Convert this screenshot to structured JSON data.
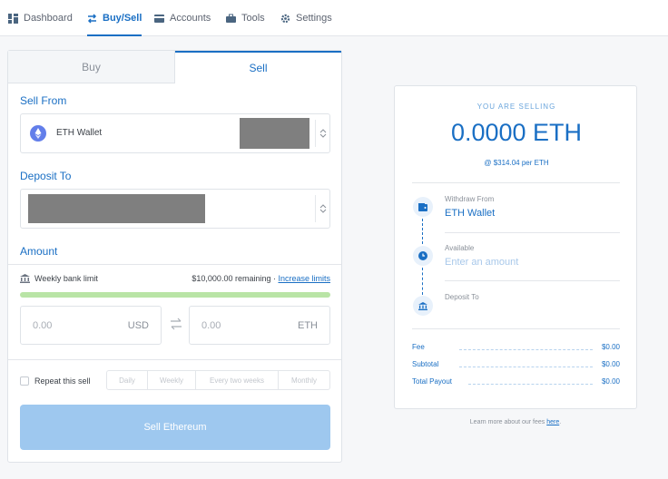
{
  "nav": {
    "items": [
      {
        "label": "Dashboard",
        "icon": "dashboard-icon"
      },
      {
        "label": "Buy/Sell",
        "icon": "swap-arrows-icon",
        "active": true
      },
      {
        "label": "Accounts",
        "icon": "accounts-icon"
      },
      {
        "label": "Tools",
        "icon": "briefcase-icon"
      },
      {
        "label": "Settings",
        "icon": "gear-icon"
      }
    ]
  },
  "tabs": {
    "buy": "Buy",
    "sell": "Sell"
  },
  "form": {
    "sell_from_label": "Sell From",
    "sell_from_value": "ETH Wallet",
    "deposit_to_label": "Deposit To",
    "amount_label": "Amount",
    "limit_label": "Weekly bank limit",
    "limit_remaining": "$10,000.00 remaining ·",
    "increase_limits": "Increase limits",
    "fiat_value": "0.00",
    "fiat_currency": "USD",
    "crypto_value": "0.00",
    "crypto_currency": "ETH",
    "repeat_label": "Repeat this sell",
    "frequencies": [
      "Daily",
      "Weekly",
      "Every two weeks",
      "Monthly"
    ],
    "submit_label": "Sell Ethereum"
  },
  "summary": {
    "kicker": "YOU ARE SELLING",
    "amount": "0.0000 ETH",
    "rate": "@ $314.04 per ETH",
    "withdraw_from_label": "Withdraw From",
    "withdraw_from_value": "ETH Wallet",
    "available_label": "Available",
    "available_value": "Enter an amount",
    "deposit_to_label": "Deposit To",
    "fees": [
      {
        "label": "Fee",
        "value": "$0.00"
      },
      {
        "label": "Subtotal",
        "value": "$0.00"
      },
      {
        "label": "Total Payout",
        "value": "$0.00"
      }
    ]
  },
  "footnote": {
    "text": "Learn more about our fees",
    "link": "here"
  },
  "colors": {
    "accent": "#1a6fc4",
    "button_disabled": "#9ec8ef",
    "limit_bar": "#b9e4a6",
    "eth": "#627eea"
  }
}
